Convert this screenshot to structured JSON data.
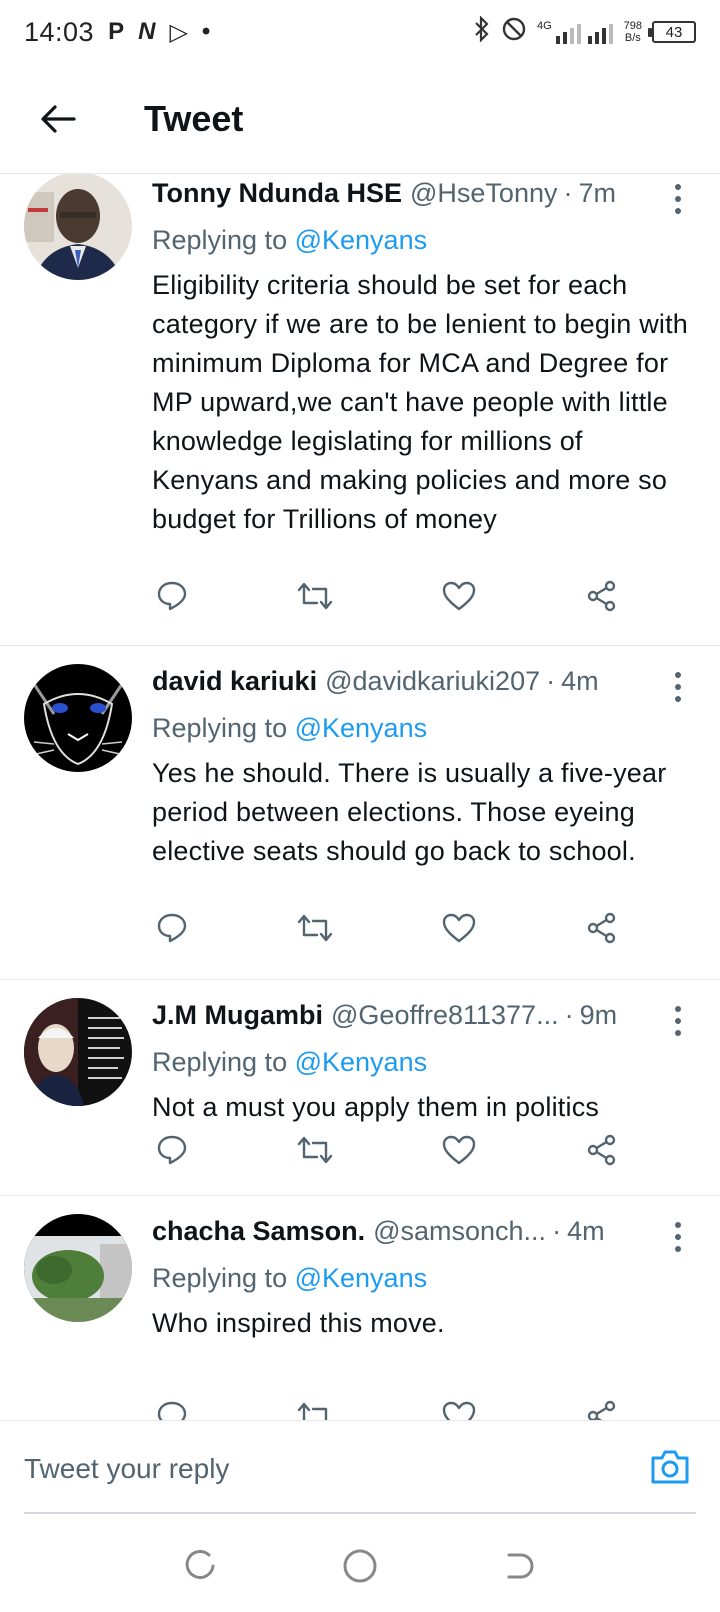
{
  "status_bar": {
    "time": "14:03",
    "icons_left": [
      "P",
      "N",
      "▷",
      "•"
    ],
    "network": "4G",
    "speed_value": "798",
    "speed_unit": "B/s",
    "battery": "43"
  },
  "header": {
    "title": "Tweet"
  },
  "tweets": [
    {
      "author": "Tonny Ndunda HSE",
      "handle": "@HseTonny",
      "time": "7m",
      "replying_prefix": "Replying to",
      "replying_to": "@Kenyans",
      "text": "Eligibility criteria should be set for each category if we are to be lenient to begin with minimum Diploma for MCA and Degree for MP upward,we can't have people with little knowledge legislating for millions of Kenyans and making policies and more so budget for Trillions of money",
      "avatar_colors": [
        "#d9d2c8",
        "#4a3a30",
        "#1d2a4a"
      ]
    },
    {
      "author": "david kariuki",
      "handle": "@davidkariuki207",
      "time": "4m",
      "replying_prefix": "Replying to",
      "replying_to": "@Kenyans",
      "text": "Yes he should. There is usually a five-year period between elections. Those eyeing elective seats should go back to school.",
      "avatar_colors": [
        "#000000",
        "#d8d8d8",
        "#2a4fd0"
      ]
    },
    {
      "author": "J.M Mugambi",
      "handle": "@Geoffre811377...",
      "time": "9m",
      "replying_prefix": "Replying to",
      "replying_to": "@Kenyans",
      "text": "Not a must you apply them in politics",
      "avatar_colors": [
        "#111111",
        "#e8dcd0",
        "#7a1c1c"
      ]
    },
    {
      "author": "chacha Samson.",
      "handle": "@samsonch...",
      "time": "4m",
      "replying_prefix": "Replying to",
      "replying_to": "@Kenyans",
      "text": "Who inspired this move.",
      "avatar_colors": [
        "#000000",
        "#4f7d3a",
        "#c8c8c8"
      ]
    }
  ],
  "composer": {
    "placeholder": "Tweet your reply"
  },
  "colors": {
    "accent": "#1d9bf0",
    "text_primary": "#0f1419",
    "text_secondary": "#536471",
    "divider": "#e5e7ea"
  },
  "icons": {
    "back": "arrow-left-icon",
    "more": "more-vertical-icon",
    "reply": "reply-icon",
    "retweet": "retweet-icon",
    "like": "heart-icon",
    "share": "share-icon",
    "camera": "camera-icon",
    "nav_recent": "recents-icon",
    "nav_home": "home-icon",
    "nav_back": "back-nav-icon"
  }
}
